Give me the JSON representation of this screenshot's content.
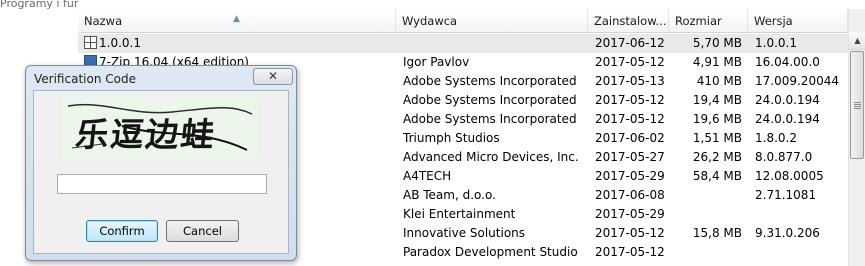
{
  "window": {
    "cut_title": "Programy i funkcje"
  },
  "columns": [
    "Nazwa",
    "Wydawca",
    "Zainstalow...",
    "Rozmiar",
    "Wersja"
  ],
  "programs": [
    {
      "name": "1.0.0.1",
      "publisher": "",
      "installed": "2017-06-12",
      "size": "5,70 MB",
      "version": "1.0.0.1",
      "icon": "generic-app-icon"
    },
    {
      "name": "7-Zip 16.04 (x64 edition)",
      "publisher": "Igor Pavlov",
      "installed": "2017-05-12",
      "size": "4,91 MB",
      "version": "16.04.00.0",
      "icon": "7zip-icon"
    },
    {
      "name": "",
      "publisher": "Adobe Systems Incorporated",
      "installed": "2017-05-13",
      "size": "410 MB",
      "version": "17.009.20044",
      "icon": ""
    },
    {
      "name": "",
      "publisher": "Adobe Systems Incorporated",
      "installed": "2017-05-12",
      "size": "19,4 MB",
      "version": "24.0.0.194",
      "icon": ""
    },
    {
      "name": "",
      "publisher": "Adobe Systems Incorporated",
      "installed": "2017-05-12",
      "size": "19,6 MB",
      "version": "24.0.0.194",
      "icon": ""
    },
    {
      "name": "",
      "publisher": "Triumph Studios",
      "installed": "2017-06-02",
      "size": "1,51 MB",
      "version": "1.8.0.2",
      "icon": ""
    },
    {
      "name": "",
      "publisher": "Advanced Micro Devices, Inc.",
      "installed": "2017-05-27",
      "size": "26,2 MB",
      "version": "8.0.877.0",
      "icon": ""
    },
    {
      "name": "",
      "publisher": "A4TECH",
      "installed": "2017-05-29",
      "size": "58,4 MB",
      "version": "12.08.0005",
      "icon": ""
    },
    {
      "name": "",
      "publisher": "AB Team, d.o.o.",
      "installed": "2017-06-08",
      "size": "",
      "version": "2.71.1081",
      "icon": ""
    },
    {
      "name": "",
      "publisher": "Klei Entertainment",
      "installed": "2017-05-29",
      "size": "",
      "version": "",
      "icon": ""
    },
    {
      "name": "",
      "publisher": "Innovative Solutions",
      "installed": "2017-05-12",
      "size": "15,8 MB",
      "version": "9.31.0.206",
      "icon": ""
    },
    {
      "name": "",
      "publisher": "Paradox Development Studio",
      "installed": "2017-05-12",
      "size": "",
      "version": "",
      "icon": ""
    }
  ],
  "dialog": {
    "title": "Verification Code",
    "close_label": "✕",
    "captcha_text": "乐逗边蛙",
    "input_value": "",
    "input_placeholder": "",
    "confirm_label": "Confirm",
    "cancel_label": "Cancel"
  },
  "colors": {
    "selection": "#e9e9e9",
    "dialog_frame": "#cfdded",
    "confirm_border": "#3c7fb1"
  }
}
